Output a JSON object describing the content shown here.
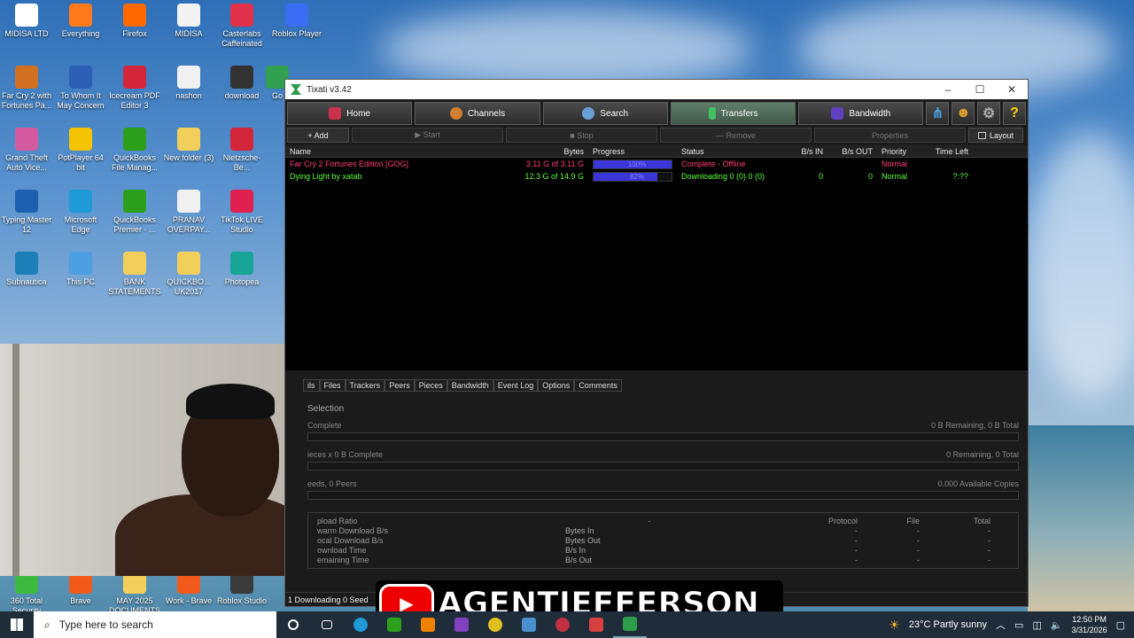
{
  "desktop": {
    "icons": [
      {
        "label": "MIDISA LTD",
        "color": "#ffffff"
      },
      {
        "label": "Everything",
        "color": "#ff7a1a"
      },
      {
        "label": "Firefox",
        "color": "#ff6a00"
      },
      {
        "label": "MIDISA",
        "color": "#f2f2f2"
      },
      {
        "label": "Casterlabs Caffeinated",
        "color": "#e0304a"
      },
      {
        "label": "Roblox Player",
        "color": "#3a6cf4"
      },
      {
        "label": "Far Cry 2 with Fortunes Pa...",
        "color": "#d07020"
      },
      {
        "label": "To Whom It May Concern",
        "color": "#2b5fb6"
      },
      {
        "label": "Icecream PDF Editor 3",
        "color": "#d4263a"
      },
      {
        "label": "nashon",
        "color": "#f0f0f0"
      },
      {
        "label": "download",
        "color": "#333333"
      },
      {
        "label": "Go",
        "color": "#30a050"
      },
      {
        "label": "Grand Theft Auto Vice...",
        "color": "#d35aa0"
      },
      {
        "label": "PotPlayer 64 bit",
        "color": "#f5c400"
      },
      {
        "label": "QuickBooks File Manag...",
        "color": "#2ca01c"
      },
      {
        "label": "New folder (3)",
        "color": "#f2cf5a"
      },
      {
        "label": "Nietzsche-Be...",
        "color": "#d4263a"
      },
      {
        "label": "Typing Master 12",
        "color": "#1d5fb0"
      },
      {
        "label": "Microsoft Edge",
        "color": "#1e9ad6"
      },
      {
        "label": "QuickBooks Premier - ...",
        "color": "#2ca01c"
      },
      {
        "label": "PRANAV OVERPAY...",
        "color": "#f0f0f0"
      },
      {
        "label": "TikTok LIVE Studio",
        "color": "#e02050"
      },
      {
        "label": "Subnautica",
        "color": "#1d7fb8"
      },
      {
        "label": "This PC",
        "color": "#4aa0e0"
      },
      {
        "label": "BANK STATEMENTS",
        "color": "#f2cf5a"
      },
      {
        "label": "QUICKBO... UK2017",
        "color": "#f2cf5a"
      },
      {
        "label": "Photopea",
        "color": "#18a497"
      },
      {
        "label": "360 Total Security",
        "color": "#3dba3d"
      },
      {
        "label": "Brave",
        "color": "#f25a1b"
      },
      {
        "label": "MAY 2025 DOCUMENTS",
        "color": "#f2cf5a"
      },
      {
        "label": "Work - Brave",
        "color": "#f25a1b"
      },
      {
        "label": "Roblox Studio",
        "color": "#3a3a3a"
      }
    ]
  },
  "window": {
    "title": "Tixati v3.42",
    "controls": {
      "minimize": "–",
      "maximize": "☐",
      "close": "✕"
    },
    "nav": [
      {
        "label": "Home",
        "color": "#c8324a"
      },
      {
        "label": "Channels",
        "color": "#d08030"
      },
      {
        "label": "Search",
        "color": "#6aa0d8"
      },
      {
        "label": "Transfers",
        "color": "#40c060"
      },
      {
        "label": "Bandwidth",
        "color": "#6040c0"
      }
    ],
    "help_label": "?",
    "actions": {
      "add": "+ Add",
      "start": "▶ Start",
      "stop": "■ Stop",
      "remove": "— Remove",
      "properties": "Properties",
      "layout": "Layout"
    },
    "columns": {
      "name": "Name",
      "bytes": "Bytes",
      "progress": "Progress",
      "status": "Status",
      "bin": "B/s IN",
      "bout": "B/s OUT",
      "priority": "Priority",
      "time_left": "Time Left"
    },
    "rows": [
      {
        "name": "Far Cry 2 Fortunes Edition [GOG]",
        "bytes": "3.11 G of 3.11 G",
        "progress": 1.0,
        "progress_label": "100%",
        "status": "Complete - Offline",
        "bin": "",
        "bout": "",
        "priority": "Normal",
        "time_left": "",
        "color": "#ff3a78"
      },
      {
        "name": "Dying Light by xatab",
        "bytes": "12.3 G of 14.9 G",
        "progress": 0.82,
        "progress_label": "82%",
        "status": "Downloading 0 (0) 0 (0)",
        "bin": "0",
        "bout": "0",
        "priority": "Normal",
        "time_left": "?:??",
        "color": "#5cff3a"
      }
    ],
    "tabs": [
      "ils",
      "Files",
      "Trackers",
      "Peers",
      "Pieces",
      "Bandwidth",
      "Event Log",
      "Options",
      "Comments"
    ],
    "details": {
      "selection": "Selection",
      "complete_left": "Complete",
      "complete_right": "0 B Remaining,  0 B Total",
      "pieces_left": "ieces  x  0 B Complete",
      "pieces_right": "0 Remaining,  0 Total",
      "seeds_left": "eeds, 0 Peers",
      "seeds_right": "0.000 Available Copies"
    },
    "stats": {
      "left_labels": [
        "pload Ratio",
        "warm Download B/s",
        "ocal Download B/s",
        "ownload Time",
        "emaining Time"
      ],
      "mid_labels": [
        "",
        "Bytes In",
        "Bytes Out",
        "B/s In",
        "B/s Out"
      ],
      "headers": [
        "Protocol",
        "File",
        "Total"
      ],
      "dash": "-"
    },
    "statusbar": "1 Downloading  0 Seed"
  },
  "banner": {
    "text": "AGENTJEFFERSON"
  },
  "taskbar": {
    "search_placeholder": "Type here to search",
    "weather": "23°C  Partly sunny",
    "time": "12:50 PM",
    "date": "3/31/2026"
  }
}
